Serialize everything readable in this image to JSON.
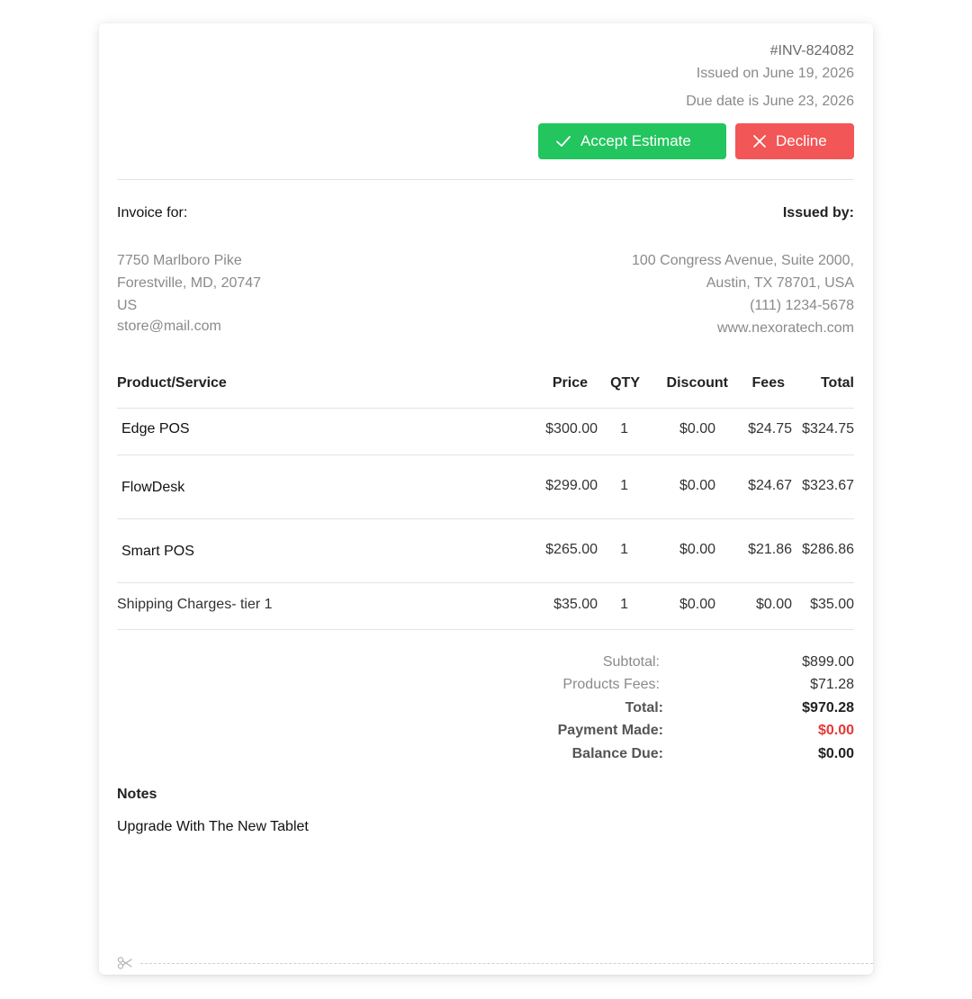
{
  "invoice": {
    "number": "#INV-824082",
    "issued": "Issued on June 19, 2026",
    "due": "Due date is June 23, 2026"
  },
  "actions": {
    "accept_label": "Accept Estimate",
    "decline_label": "Decline"
  },
  "billing": {
    "for_label": "Invoice for:",
    "for_lines": [
      "7750 Marlboro Pike",
      "Forestville, MD, 20747",
      "US",
      "store@mail.com"
    ],
    "by_label": "Issued by:",
    "by_lines": [
      "100 Congress Avenue, Suite 2000,",
      "Austin, TX 78701, USA",
      "(111) 1234-5678",
      "www.nexoratech.com"
    ]
  },
  "table": {
    "headers": {
      "product": "Product/Service",
      "price": "Price",
      "qty": "QTY",
      "discount": "Discount",
      "fees": "Fees",
      "total": "Total"
    },
    "rows": [
      {
        "name": "Edge POS",
        "price": "$300.00",
        "qty": "1",
        "discount": "$0.00",
        "fees": "$24.75",
        "total": "$324.75"
      },
      {
        "name": "FlowDesk",
        "price": "$299.00",
        "qty": "1",
        "discount": "$0.00",
        "fees": "$24.67",
        "total": "$323.67"
      },
      {
        "name": "Smart POS",
        "price": "$265.00",
        "qty": "1",
        "discount": "$0.00",
        "fees": "$21.86",
        "total": "$286.86"
      },
      {
        "name": "Shipping Charges- tier 1",
        "price": "$35.00",
        "qty": "1",
        "discount": "$0.00",
        "fees": "$0.00",
        "total": "$35.00"
      }
    ]
  },
  "totals": {
    "subtotal_label": "Subtotal:",
    "subtotal": "$899.00",
    "fees_label": "Products Fees:",
    "fees": "$71.28",
    "total_label": "Total:",
    "total": "$970.28",
    "payment_label": "Payment Made:",
    "payment": "$0.00",
    "balance_label": "Balance Due:",
    "balance": "$0.00"
  },
  "notes": {
    "label": "Notes",
    "text": "Upgrade With The New Tablet"
  },
  "colors": {
    "accept": "#22c55e",
    "decline": "#f25656",
    "payment_red": "#e53935"
  }
}
